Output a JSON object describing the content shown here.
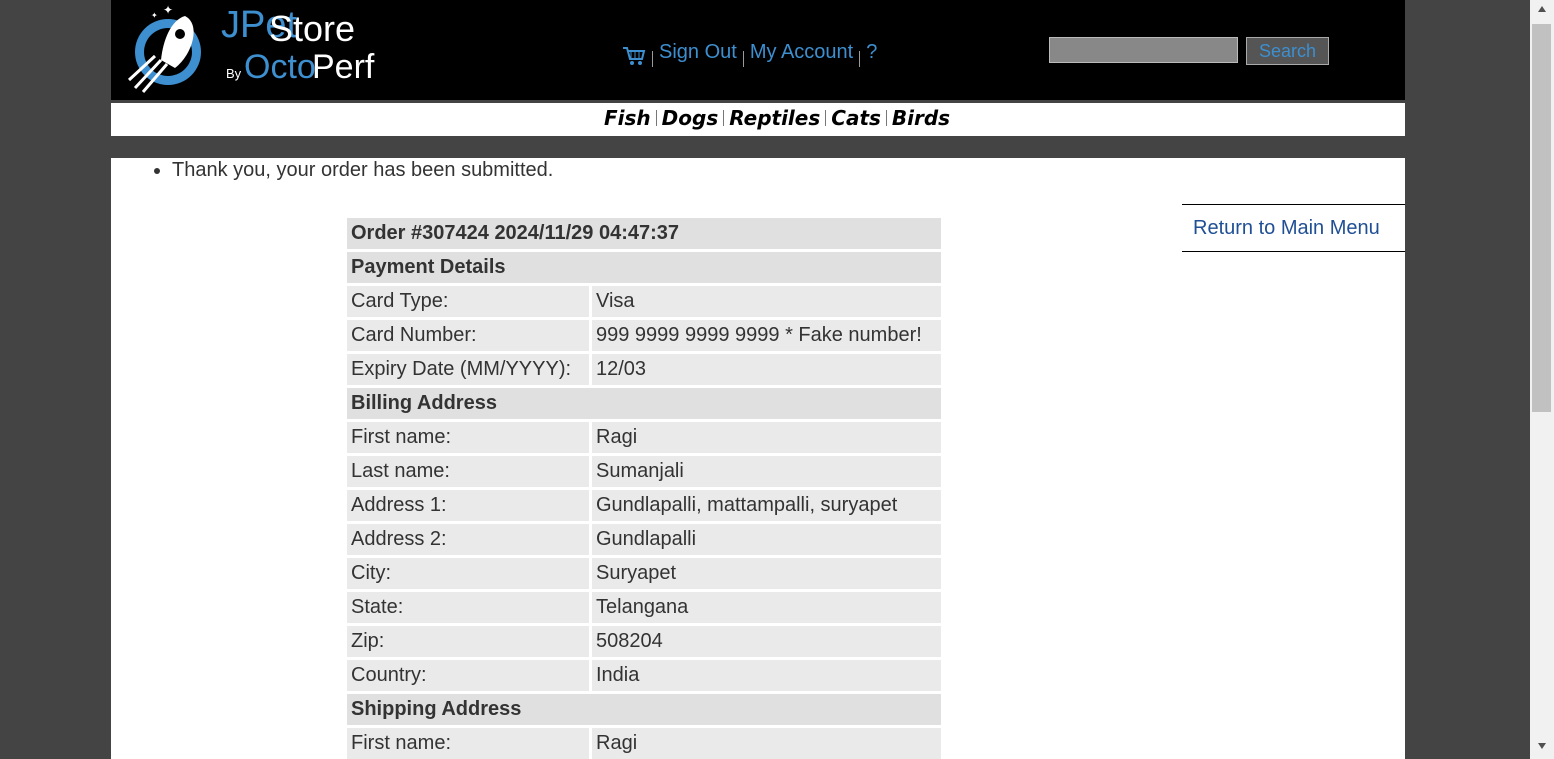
{
  "header": {
    "logo": {
      "j_pet": "JPet",
      "store": "Store",
      "by": "By",
      "octo": "Octo",
      "perf": "Perf"
    },
    "menu": {
      "cart_icon": "cart-icon",
      "sign_out": "Sign Out",
      "my_account": "My Account",
      "help": "?"
    },
    "search": {
      "input_value": "",
      "button_label": "Search"
    }
  },
  "quicklinks": [
    "Fish",
    "Dogs",
    "Reptiles",
    "Cats",
    "Birds"
  ],
  "messages": [
    "Thank you, your order has been submitted."
  ],
  "return_link": "Return to Main Menu",
  "order": {
    "title": "Order #307424 2024/11/29 04:47:37",
    "payment_header": "Payment Details",
    "payment": [
      {
        "label": "Card Type:",
        "value": "Visa"
      },
      {
        "label": "Card Number:",
        "value": "999 9999 9999 9999 * Fake number!"
      },
      {
        "label": "Expiry Date (MM/YYYY):",
        "value": "12/03"
      }
    ],
    "billing_header": "Billing Address",
    "billing": [
      {
        "label": "First name:",
        "value": "Ragi"
      },
      {
        "label": "Last name:",
        "value": "Sumanjali"
      },
      {
        "label": "Address 1:",
        "value": "Gundlapalli, mattampalli, suryapet"
      },
      {
        "label": "Address 2:",
        "value": "Gundlapalli"
      },
      {
        "label": "City:",
        "value": "Suryapet"
      },
      {
        "label": "State:",
        "value": "Telangana"
      },
      {
        "label": "Zip:",
        "value": "508204"
      },
      {
        "label": "Country:",
        "value": "India"
      }
    ],
    "shipping_header": "Shipping Address",
    "shipping": [
      {
        "label": "First name:",
        "value": "Ragi"
      }
    ]
  },
  "colors": {
    "link": "#3d8fd0",
    "return_link": "#1f4f94",
    "header_bg": "#000000",
    "page_bg": "#444444"
  }
}
